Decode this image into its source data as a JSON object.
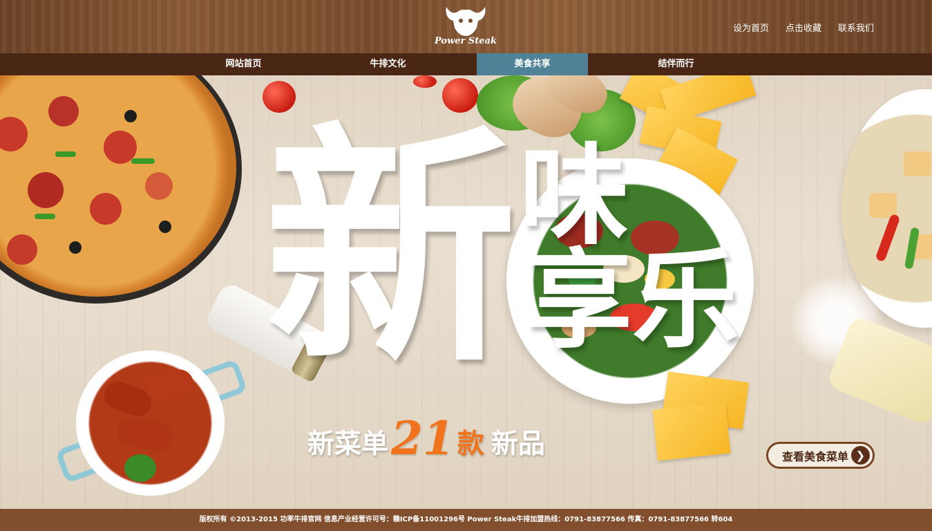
{
  "header": {
    "logo_text": "Power Steak",
    "links": [
      "设为首页",
      "点击收藏",
      "联系我们"
    ]
  },
  "nav": {
    "items": [
      "网站首页",
      "牛排文化",
      "美食共享",
      "结伴而行"
    ],
    "active_index": 2
  },
  "banner": {
    "headline_1": "新",
    "headline_2": "味",
    "headline_3": "享乐",
    "subline_prefix": "新菜单",
    "subline_number": "21",
    "subline_unit": "款",
    "subline_suffix": "新品",
    "menu_button": "查看美食菜单",
    "menu_button_icon": "chevron-right-icon"
  },
  "footer": {
    "text": "版权所有 ©2013-2015 功率牛排官网  信息产业经营许可号：赣ICP备11001296号    Power Steak牛排加盟热线：0791-83877566 传真：0791-83877566 转604"
  },
  "colors": {
    "header_wood": "#7a4d2d",
    "nav_bg": "#4a2715",
    "nav_active": "#4f8197",
    "accent_orange": "#f1731b",
    "footer_bg": "#824f2e"
  }
}
